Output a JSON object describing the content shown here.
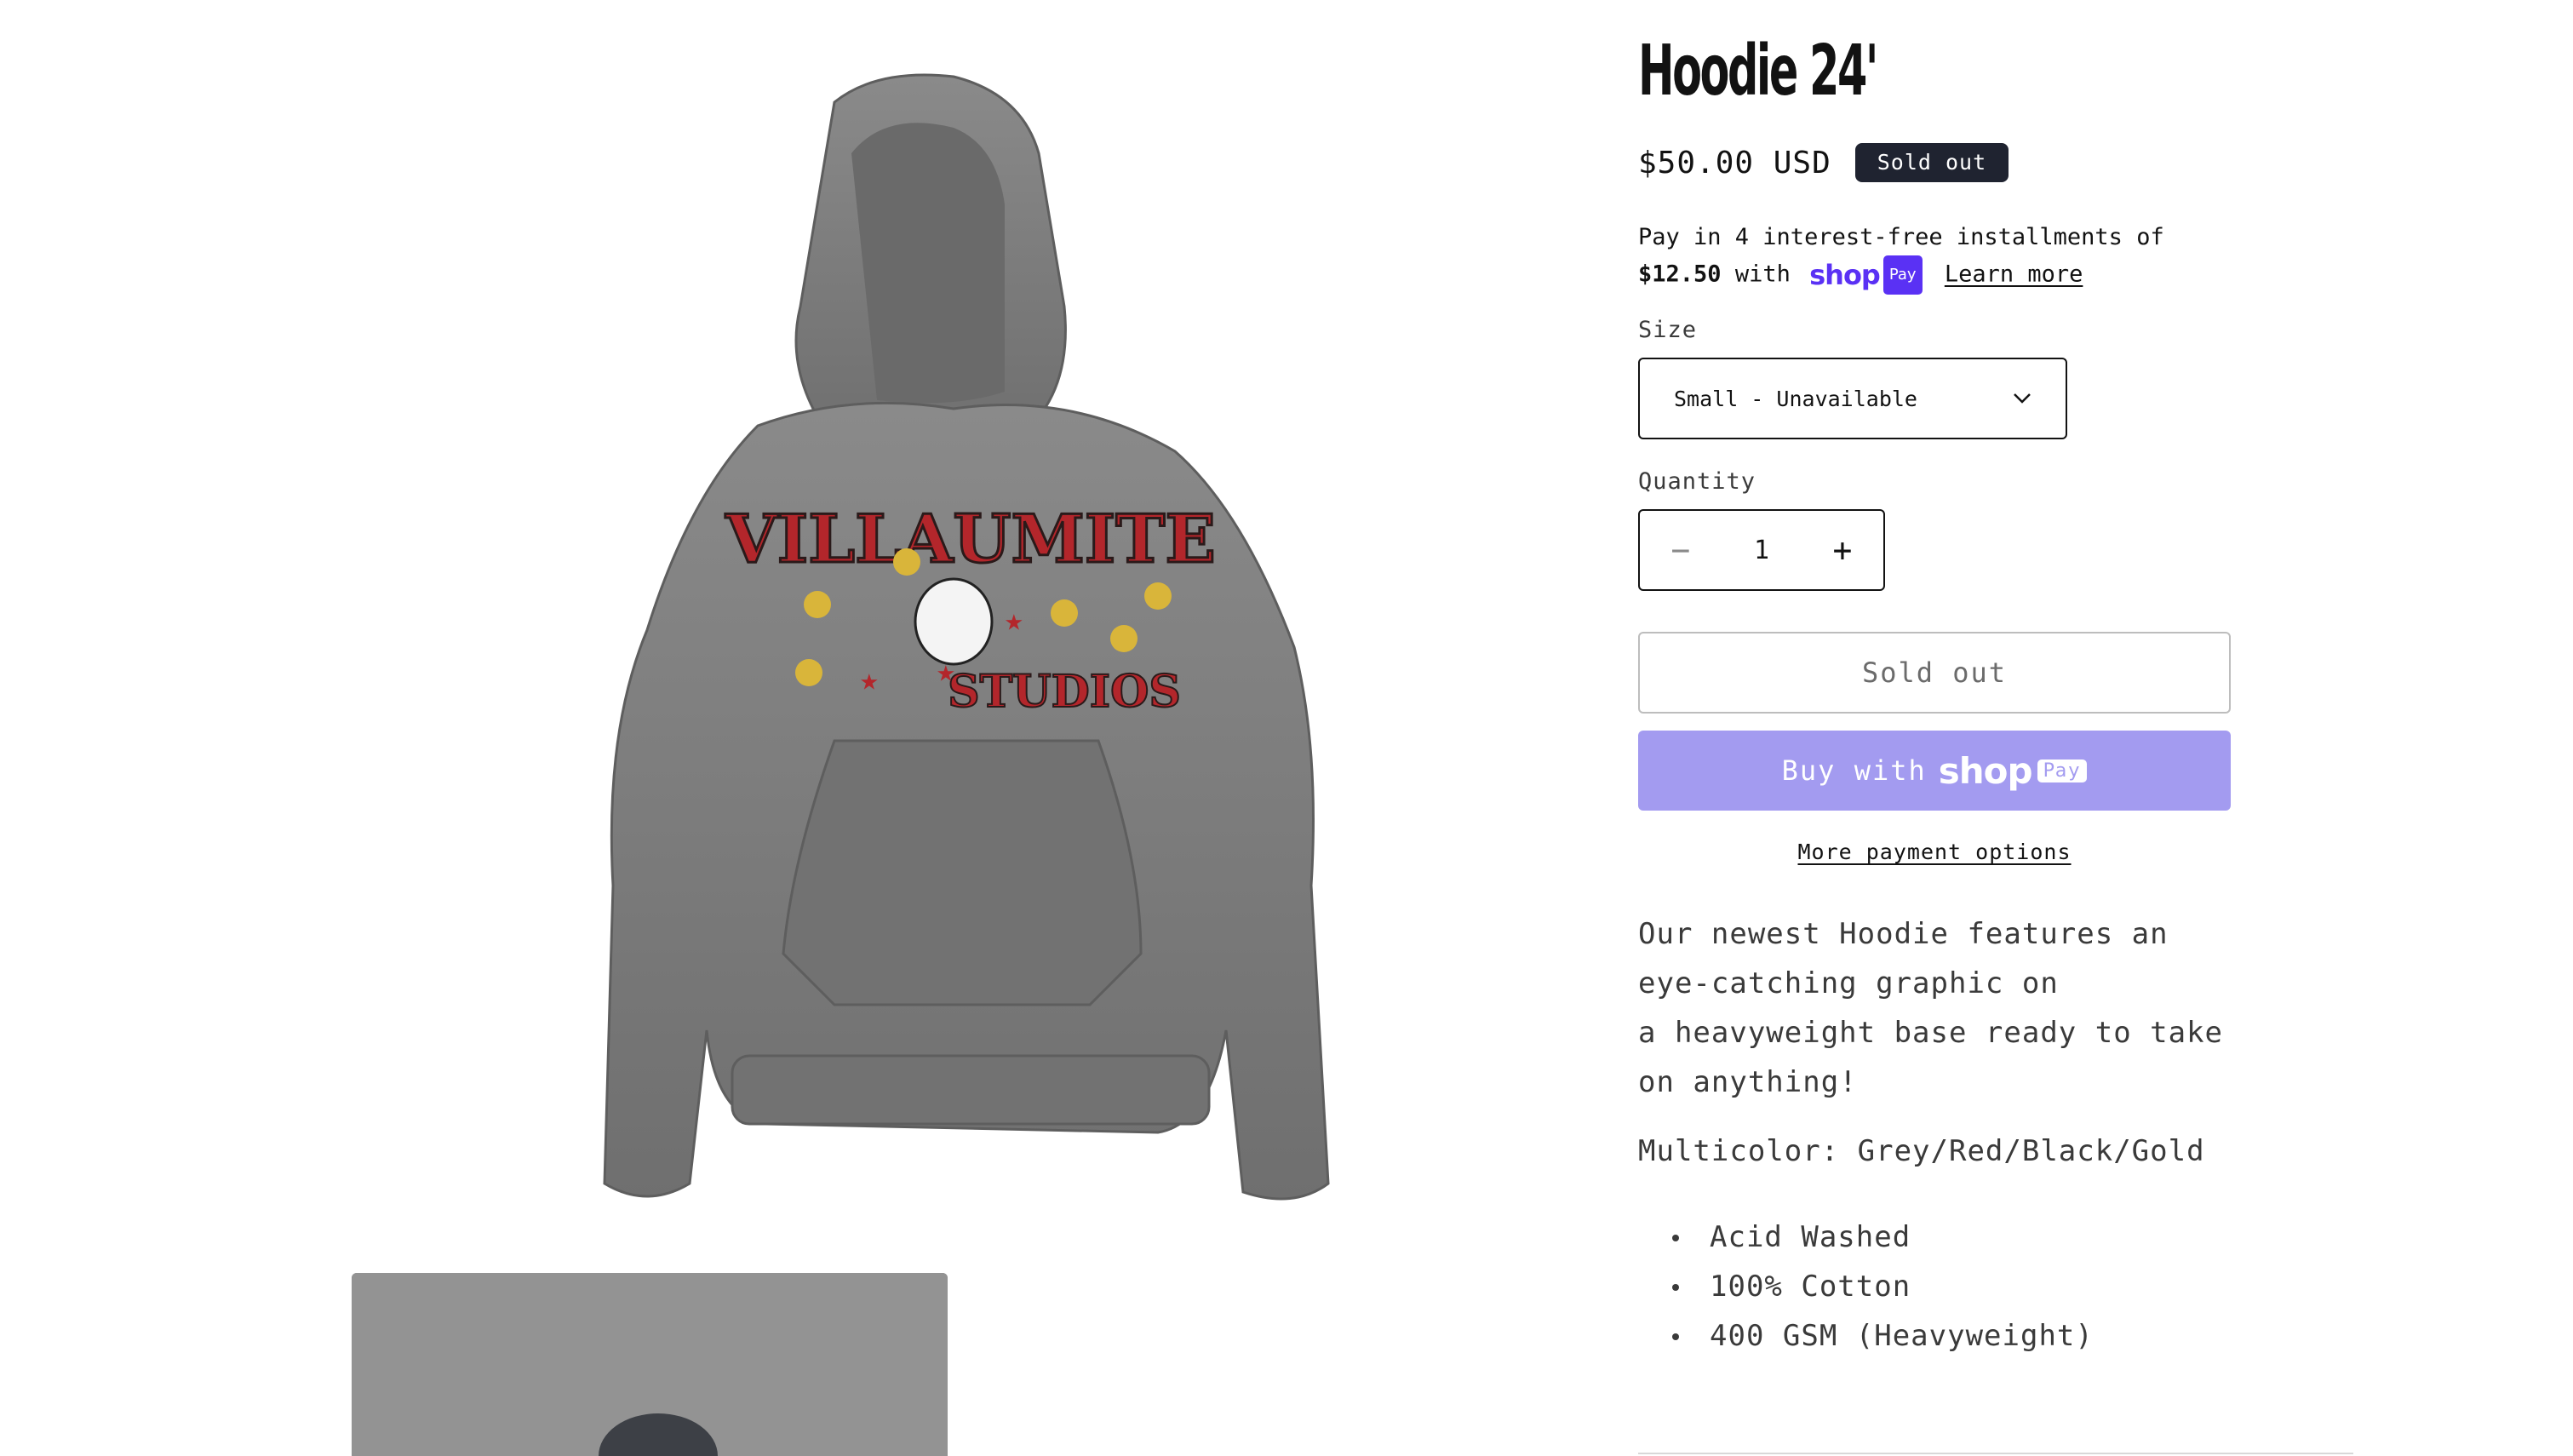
{
  "product": {
    "title": "Hoodie 24'",
    "price": "$50.00 USD",
    "badge": "Sold out",
    "installments": {
      "prefix": "Pay in 4 interest-free installments of",
      "amount": "$12.50",
      "with": "with",
      "shop_word": "shop",
      "pay_word": "Pay",
      "learn_more": "Learn more"
    },
    "size": {
      "label": "Size",
      "selected": "Small - Unavailable"
    },
    "quantity": {
      "label": "Quantity",
      "value": "1",
      "minus": "−",
      "plus": "+"
    },
    "buttons": {
      "sold_out": "Sold out",
      "buy_with": "Buy with",
      "shop_word": "shop",
      "pay_word": "Pay",
      "more_payment": "More payment options"
    },
    "description": {
      "line1": "Our newest Hoodie features an",
      "line2": "eye-catching graphic on",
      "line3": "a heavyweight base ready to take",
      "line4": "on anything!",
      "multicolor": "Multicolor: Grey/Red/Black/Gold",
      "bullets": [
        "Acid Washed",
        "100% Cotton",
        "400 GSM (Heavyweight)"
      ]
    },
    "graphic_text": {
      "top": "VILLAUMITE",
      "bottom": "STUDIOS"
    }
  },
  "colors": {
    "shop_purple": "#5a31f4",
    "shop_button": "#a39bf0",
    "badge_bg": "#1f2330",
    "hoodie_grey": "#7b7b7b",
    "graphic_red": "#b3262b",
    "coin_gold": "#d9b53a"
  },
  "icons": {
    "select": "chevron-down-icon",
    "minus": "minus-icon",
    "plus": "plus-icon"
  }
}
